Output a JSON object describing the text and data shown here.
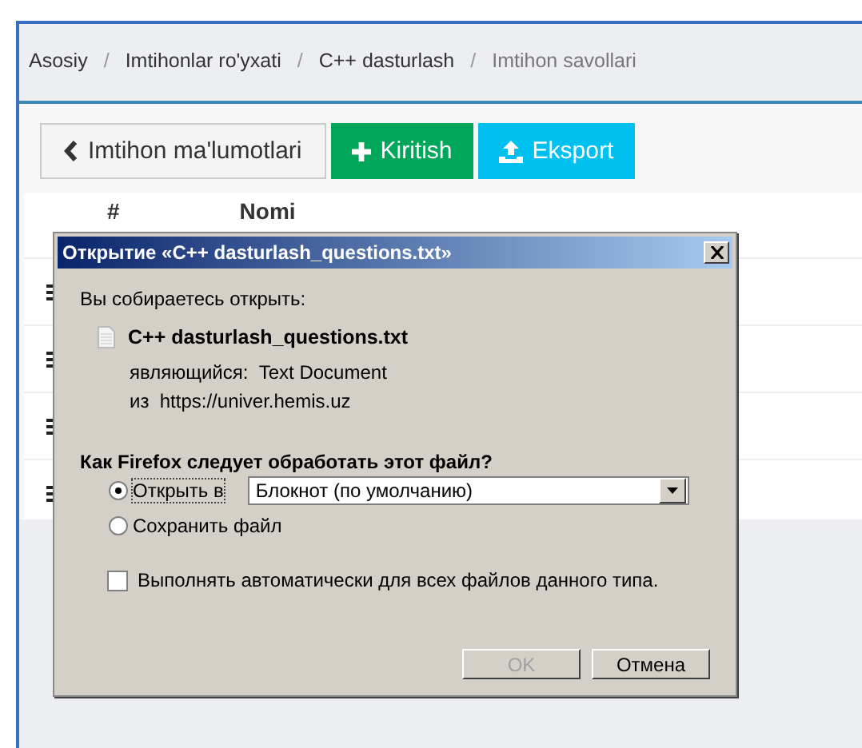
{
  "breadcrumb": [
    {
      "label": "Asosiy",
      "current": false
    },
    {
      "separator": "/",
      "label": "Imtihonlar ro'yxati",
      "current": false
    },
    {
      "separator": "/",
      "label": "C++ dasturlash",
      "current": false
    },
    {
      "separator": "/",
      "label": "Imtihon savollari",
      "current": true
    }
  ],
  "toolbar": [
    {
      "kind": "back",
      "label": "Imtihon ma'lumotlari"
    },
    {
      "kind": "add",
      "label": "Kiritish"
    },
    {
      "kind": "export",
      "label": "Eksport"
    }
  ],
  "table": {
    "columns": [
      "#",
      "Nomi"
    ],
    "rows": [
      {
        "kind": "handle"
      },
      {
        "kind": "handle"
      },
      {
        "kind": "handle"
      },
      {
        "kind": "handle"
      }
    ]
  },
  "dialog": {
    "title": "Открытие «C++ dasturlash_questions.txt»",
    "intro": "Вы собираетесь открыть:",
    "file_name": "C++ dasturlash_questions.txt",
    "type_label": "являющийся:",
    "type_value": "Text Document",
    "source_label": "из",
    "source_value": "https://univer.hemis.uz",
    "question": "Как Firefox следует обработать этот файл?",
    "options": [
      {
        "label": "Открыть в",
        "selected": true
      },
      {
        "label": "Сохранить файл",
        "selected": false
      }
    ],
    "app_select": {
      "value": "Блокнот (по умолчанию)"
    },
    "auto_checkbox": {
      "label": "Выполнять автоматически для всех файлов данного типа.",
      "checked": false
    },
    "buttons": [
      {
        "label": "OK",
        "disabled": true
      },
      {
        "label": "Отмена",
        "disabled": false
      }
    ]
  }
}
